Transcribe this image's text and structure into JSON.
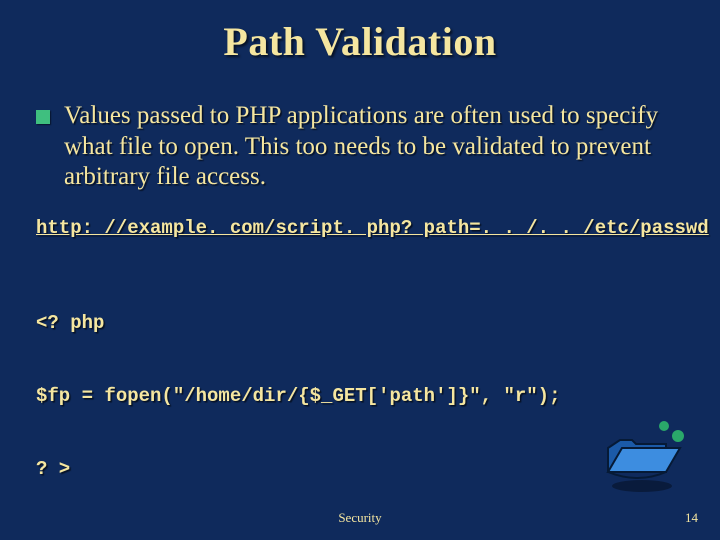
{
  "title": "Path Validation",
  "bullet": "Values passed to PHP applications are often used to specify what file to open. This too needs to be validated to prevent arbitrary file access.",
  "url_line": "http: //example. com/script. php? path=. . /. . /etc/passwd",
  "code_line1": "<? php",
  "code_line2": "$fp = fopen(\"/home/dir/{$_GET['path']}\", \"r\");",
  "code_line3": "? >",
  "footer_center": "Security",
  "footer_right": "14"
}
